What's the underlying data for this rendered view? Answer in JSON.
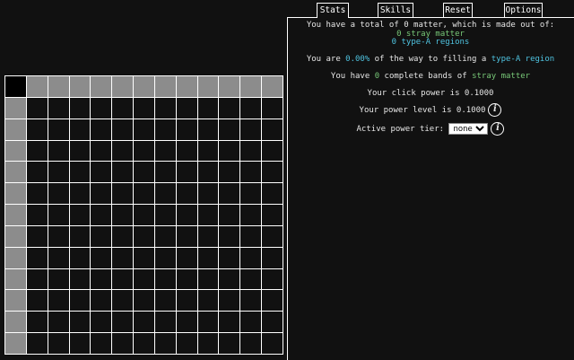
{
  "tabs": [
    "Stats",
    "Skills",
    "Reset",
    "Options"
  ],
  "stats": {
    "matter_prefix": "You have a total of ",
    "matter_total": "0",
    "matter_suffix": " matter, which is made out of:",
    "stray_count": "0",
    "stray_label": " stray matter",
    "typea_count": "0",
    "typea_label": " type-A regions",
    "fill_prefix": "You are ",
    "fill_percent": "0.00%",
    "fill_middle": " of the way to filling a ",
    "fill_target": "type-A region",
    "bands_prefix": "You have ",
    "bands_count": "0",
    "bands_middle": " complete bands of ",
    "bands_target": "stray matter",
    "click_power": "Your click power is 0.1000",
    "power_level": "Your power level is 0.1000",
    "power_tier_label": "Active power tier:",
    "power_tier_value": "none",
    "power_tier_options": [
      "none"
    ]
  },
  "grid": {
    "size": 13,
    "filled_top_row": 12,
    "filled_left_col": 12
  },
  "colors": {
    "background": "#111111",
    "cell_filled": "#8c8c8c",
    "cyan": "#4fc3e0",
    "green": "#78c878"
  },
  "icons": [
    "info-icon",
    "info-icon"
  ]
}
